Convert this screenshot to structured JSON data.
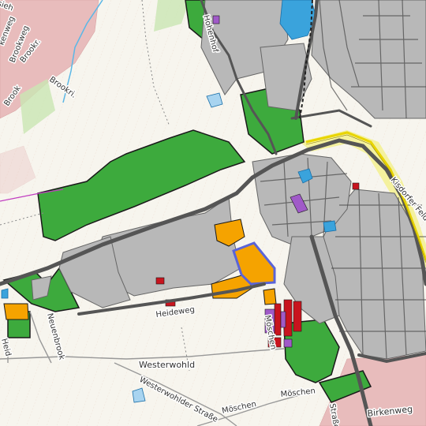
{
  "map": {
    "colors": {
      "background": "#f7f5ee",
      "green_area": "#3daa3d",
      "grey_block": "#b8b8b8",
      "orange_area": "#f5a300",
      "red_area": "#c8141e",
      "purple_area": "#a05ac8",
      "water": "#3aa3dc",
      "residential_pink": "#e8bcbc",
      "motorway_yellow": "#f2f08a",
      "highlight_outline": "#5a64d8",
      "road_dark": "#555555"
    },
    "street_labels": {
      "brookweg": "Brookweg",
      "brook": "Brook",
      "brookr_1": "Brookr.",
      "brookr_2": "Brookri.",
      "hohenhof": "Hohenhof",
      "kisdorfer_feld": "Kisdorfer Feld",
      "heideweg": "Heideweg",
      "neuenbrook": "Neuenbrook",
      "westerwohld": "Westerwohld",
      "westerwohlder_strasse": "Westerwohlder Straße",
      "moschen_1": "Möschen",
      "moschen_2": "Möschen",
      "moschen_vertical": "Möschen",
      "birkenweg": "Birkenweg",
      "heid": "Heid",
      "strasse_partial": "Straße",
      "sieh_partial": "sieh",
      "kenweg_partial": "kenweg"
    }
  }
}
